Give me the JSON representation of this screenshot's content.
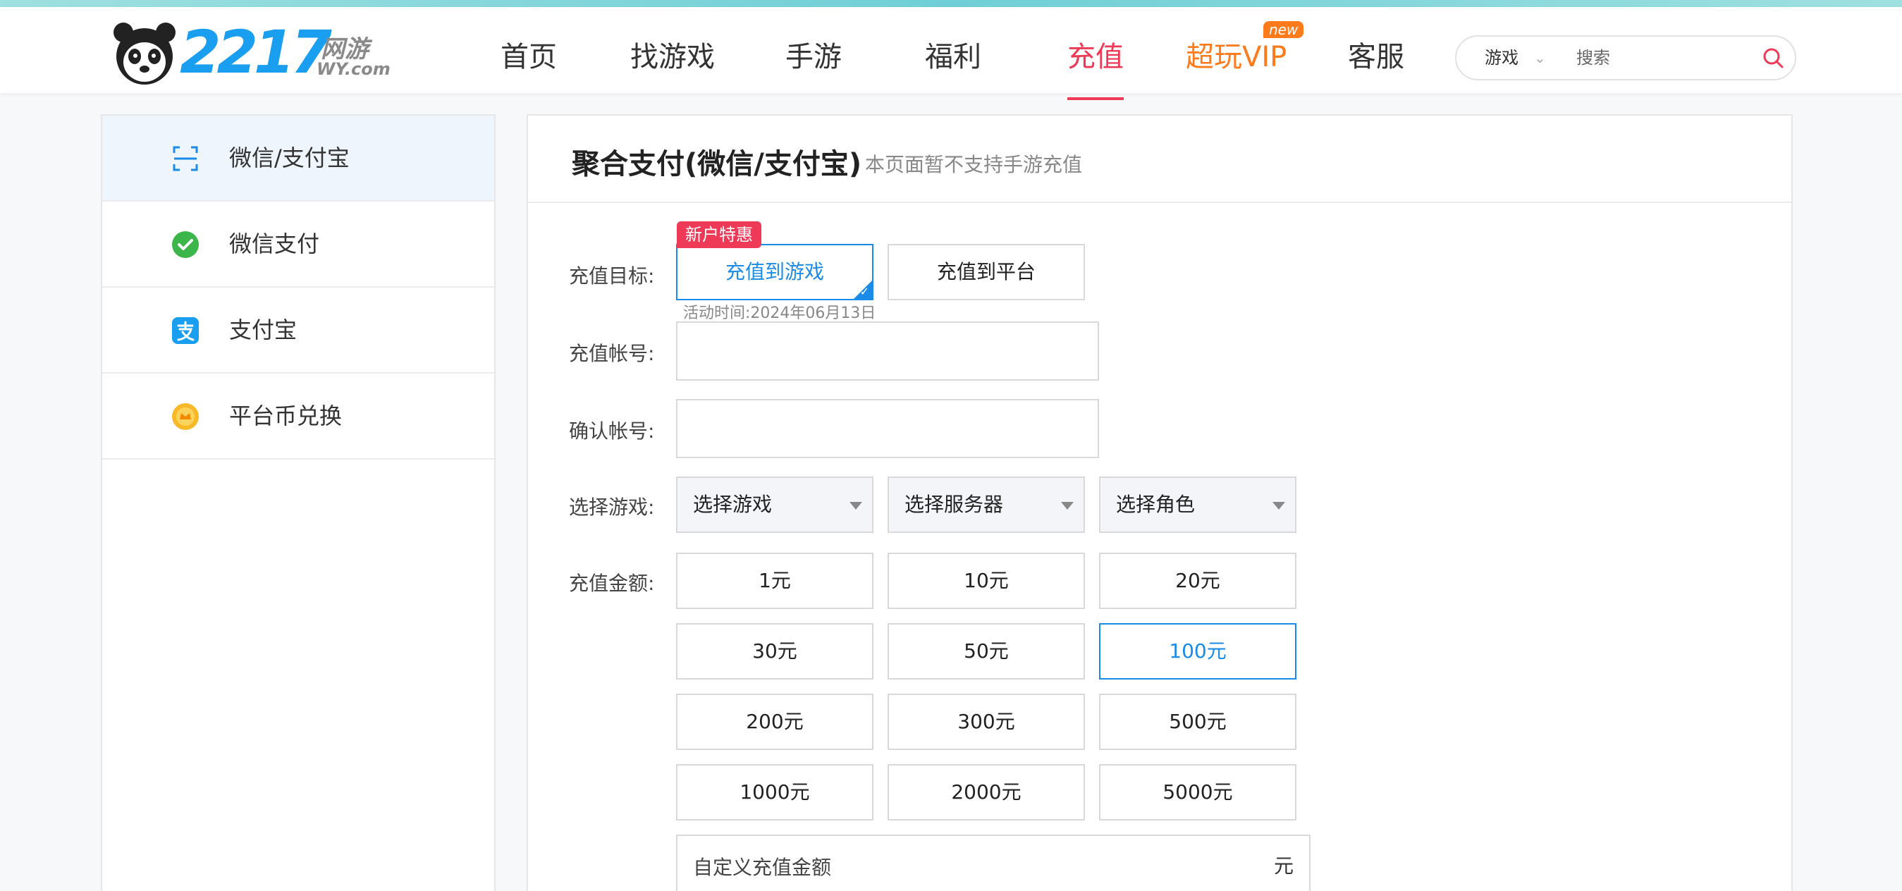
{
  "brand": {
    "number": "2217",
    "cn": "网游",
    "sub": "WY.com"
  },
  "nav": {
    "items": [
      {
        "label": "首页"
      },
      {
        "label": "找游戏"
      },
      {
        "label": "手游"
      },
      {
        "label": "福利"
      },
      {
        "label": "充值",
        "active": true
      },
      {
        "label": "超玩VIP",
        "badge": "new"
      },
      {
        "label": "客服"
      }
    ]
  },
  "search": {
    "category": "游戏",
    "placeholder": "搜索"
  },
  "sidebar": {
    "items": [
      {
        "label": "微信/支付宝",
        "icon": "scan-icon",
        "active": true
      },
      {
        "label": "微信支付",
        "icon": "wechat-icon"
      },
      {
        "label": "支付宝",
        "icon": "alipay-icon"
      },
      {
        "label": "平台币兑换",
        "icon": "coin-icon"
      }
    ]
  },
  "main": {
    "title": "聚合支付(微信/支付宝)",
    "note": "本页面暂不支持手游充值",
    "form": {
      "target_label": "充值目标:",
      "targets": [
        "充值到游戏",
        "充值到平台"
      ],
      "promo_badge": "新户特惠",
      "activity": "活动时间:2024年06月13日",
      "account_label": "充值帐号:",
      "confirm_label": "确认帐号:",
      "game_label": "选择游戏:",
      "selects": [
        "选择游戏",
        "选择服务器",
        "选择角色"
      ],
      "amount_label": "充值金额:",
      "amounts": [
        "1元",
        "10元",
        "20元",
        "30元",
        "50元",
        "100元",
        "200元",
        "300元",
        "500元",
        "1000元",
        "2000元",
        "5000元"
      ],
      "selected_amount": "100元",
      "custom_placeholder": "自定义充值金额",
      "custom_unit": "元"
    }
  },
  "colors": {
    "accent": "#1a8be6",
    "nav_active": "#ee3a57",
    "vip": "#ff7a1a"
  }
}
